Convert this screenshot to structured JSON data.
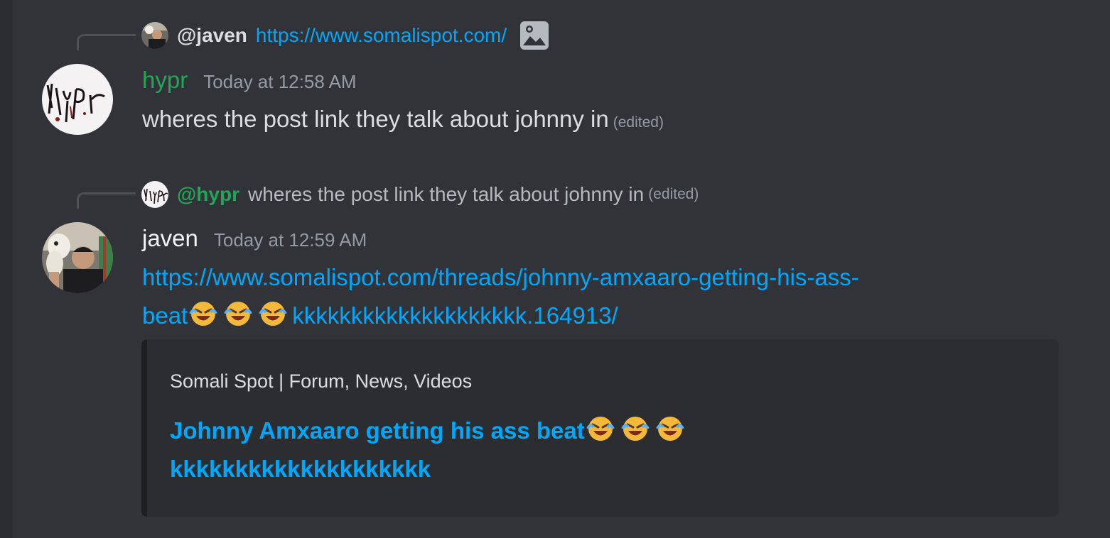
{
  "messages": [
    {
      "reply": {
        "name": "@javen",
        "text": "https://www.somalispot.com/",
        "name_color": "#dbdee1",
        "text_is_link": true,
        "has_image_icon": true
      },
      "author": "hypr",
      "author_color": "#23a559",
      "timestamp": "Today at 12:58 AM",
      "content": "wheres the post link they talk about johnny in",
      "edited": "(edited)"
    },
    {
      "reply": {
        "name": "@hypr",
        "text": "wheres the post link they talk about johnny in",
        "edited": "(edited)",
        "name_color": "#23a559"
      },
      "author": "javen",
      "author_color": "#f2f3f5",
      "timestamp": "Today at 12:59 AM",
      "link_line1": "https://www.somalispot.com/threads/johnny-amxaaro-getting-his-ass-",
      "link_line2_start": "beat",
      "link_line2_end": "kkkkkkkkkkkkkkkkkkkk.164913/",
      "embed": {
        "provider": "Somali Spot | Forum, News, Videos",
        "title_line1": "Johnny Amxaaro getting his ass beat",
        "title_line2": "kkkkkkkkkkkkkkkkkkkk"
      }
    }
  ],
  "icons": {
    "emoji": "rolling-on-floor-laughing-emoji",
    "image": "image-attachment-icon"
  },
  "colors": {
    "background": "#313338",
    "link": "#00a8fc",
    "embed_bg": "#2b2d31",
    "muted": "#949ba4"
  }
}
